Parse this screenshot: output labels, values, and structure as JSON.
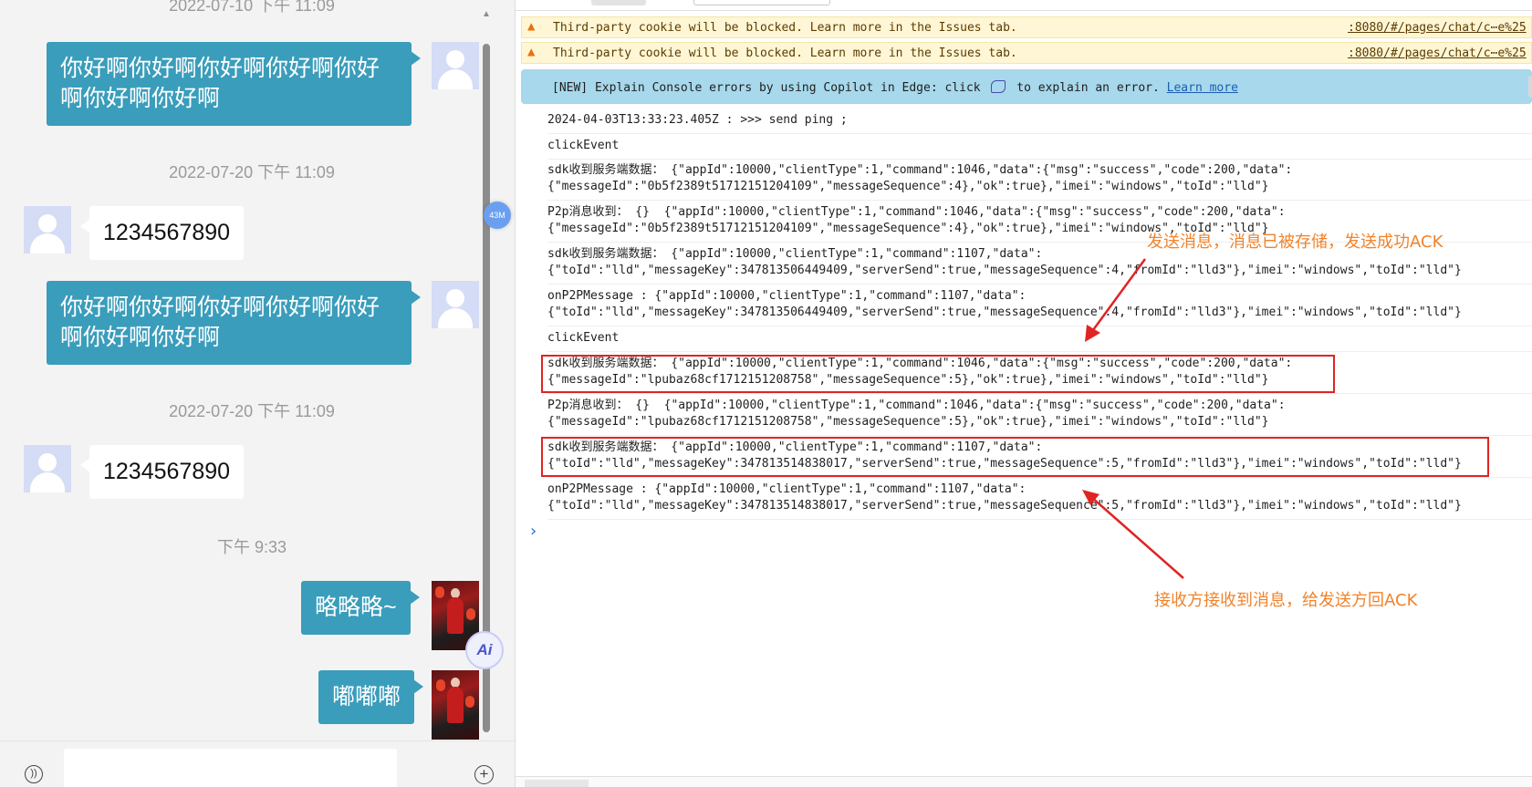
{
  "chat": {
    "timestamp_top": "2022-07-10 下午 11:09",
    "messages": [
      {
        "side": "out",
        "text": "你好啊你好啊你好啊你好啊你好啊你好啊你好啊"
      },
      {
        "side": "ts",
        "text": "2022-07-20 下午 11:09"
      },
      {
        "side": "in",
        "text": "1234567890"
      },
      {
        "side": "out",
        "text": "你好啊你好啊你好啊你好啊你好啊你好啊你好啊"
      },
      {
        "side": "ts",
        "text": "2022-07-20 下午 11:09"
      },
      {
        "side": "in",
        "text": "1234567890"
      },
      {
        "side": "ts",
        "text": "下午 9:33"
      },
      {
        "side": "out",
        "text": "略略略~"
      },
      {
        "side": "out",
        "text": "嘟嘟嘟"
      }
    ],
    "badge": "43M",
    "ai_label": "Ai",
    "input_value": ""
  },
  "console": {
    "warnings": [
      {
        "text": "Third-party cookie will be blocked. Learn more in the Issues tab.",
        "link": ":8080/#/pages/chat/c⋯e%25"
      },
      {
        "text": "Third-party cookie will be blocked. Learn more in the Issues tab.",
        "link": ":8080/#/pages/chat/c⋯e%25"
      }
    ],
    "banner": {
      "text_before": "[NEW] Explain Console errors by using Copilot in Edge: click",
      "text_after": "to explain an error.",
      "link": "Learn more"
    },
    "logs": [
      [
        "2024-04-03T13:33:23.405Z : >>> send ping ;"
      ],
      [
        "clickEvent"
      ],
      [
        "sdk收到服务端数据： {\"appId\":10000,\"clientType\":1,\"command\":1046,\"data\":{\"msg\":\"success\",\"code\":200,\"data\":",
        "{\"messageId\":\"0b5f2389t51712151204109\",\"messageSequence\":4},\"ok\":true},\"imei\":\"windows\",\"toId\":\"lld\"}"
      ],
      [
        "P2p消息收到： {}  {\"appId\":10000,\"clientType\":1,\"command\":1046,\"data\":{\"msg\":\"success\",\"code\":200,\"data\":",
        "{\"messageId\":\"0b5f2389t51712151204109\",\"messageSequence\":4},\"ok\":true},\"imei\":\"windows\",\"toId\":\"lld\"}"
      ],
      [
        "sdk收到服务端数据： {\"appId\":10000,\"clientType\":1,\"command\":1107,\"data\":",
        "{\"toId\":\"lld\",\"messageKey\":347813506449409,\"serverSend\":true,\"messageSequence\":4,\"fromId\":\"lld3\"},\"imei\":\"windows\",\"toId\":\"lld\"}"
      ],
      [
        "onP2PMessage : {\"appId\":10000,\"clientType\":1,\"command\":1107,\"data\":",
        "{\"toId\":\"lld\",\"messageKey\":347813506449409,\"serverSend\":true,\"messageSequence\":4,\"fromId\":\"lld3\"},\"imei\":\"windows\",\"toId\":\"lld\"}"
      ],
      [
        "clickEvent"
      ],
      [
        "sdk收到服务端数据： {\"appId\":10000,\"clientType\":1,\"command\":1046,\"data\":{\"msg\":\"success\",\"code\":200,\"data\":",
        "{\"messageId\":\"lpubaz68cf1712151208758\",\"messageSequence\":5},\"ok\":true},\"imei\":\"windows\",\"toId\":\"lld\"}"
      ],
      [
        "P2p消息收到： {}  {\"appId\":10000,\"clientType\":1,\"command\":1046,\"data\":{\"msg\":\"success\",\"code\":200,\"data\":",
        "{\"messageId\":\"lpubaz68cf1712151208758\",\"messageSequence\":5},\"ok\":true},\"imei\":\"windows\",\"toId\":\"lld\"}"
      ],
      [
        "sdk收到服务端数据： {\"appId\":10000,\"clientType\":1,\"command\":1107,\"data\":",
        "{\"toId\":\"lld\",\"messageKey\":347813514838017,\"serverSend\":true,\"messageSequence\":5,\"fromId\":\"lld3\"},\"imei\":\"windows\",\"toId\":\"lld\"}"
      ],
      [
        "onP2PMessage : {\"appId\":10000,\"clientType\":1,\"command\":1107,\"data\":",
        "{\"toId\":\"lld\",\"messageKey\":347813514838017,\"serverSend\":true,\"messageSequence\":5,\"fromId\":\"lld3\"},\"imei\":\"windows\",\"toId\":\"lld\"}"
      ]
    ],
    "prompt": "›"
  },
  "annotations": {
    "top": "发送消息，消息已被存储，发送成功ACK",
    "bottom": "接收方接收到消息，给发送方回ACK",
    "color": "#f0832c",
    "box_color": "#e02424"
  }
}
